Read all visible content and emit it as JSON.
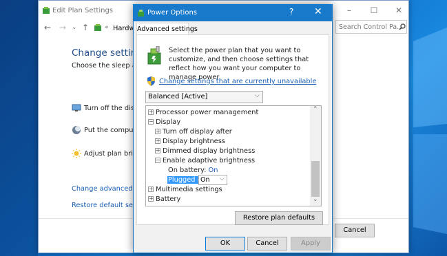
{
  "background_window": {
    "title": "Edit Plan Settings",
    "breadcrumb": "Hardwa",
    "search_placeholder": "Search Control Pa...",
    "heading": "Change settings",
    "subheading": "Choose the sleep and",
    "rows": [
      "Turn off the displa",
      "Put the computer",
      "Adjust plan bright"
    ],
    "links": [
      "Change advanced pov",
      "Restore default setting"
    ],
    "cancel_label": "Cancel"
  },
  "dialog": {
    "title": "Power Options",
    "help_label": "?",
    "close_label": "✕",
    "tab_label": "Advanced settings",
    "intro_text": "Select the power plan that you want to customize, and then choose settings that reflect how you want your computer to manage power.",
    "change_link": "Change settings that are currently unavailable",
    "plan_selected": "Balanced [Active]",
    "tree": {
      "processor": "Processor power management",
      "display": "Display",
      "turn_off_display": "Turn off display after",
      "display_brightness": "Display brightness",
      "dimmed_brightness": "Dimmed display brightness",
      "adaptive_brightness": "Enable adaptive brightness",
      "on_battery_label": "On battery:",
      "on_battery_value": "On",
      "plugged_in_label": "Plugged in:",
      "plugged_in_value": "On",
      "multimedia": "Multimedia settings",
      "battery": "Battery"
    },
    "restore_label": "Restore plan defaults",
    "ok_label": "OK",
    "cancel_label": "Cancel",
    "apply_label": "Apply"
  },
  "colors": {
    "title_bar": "#1979ca",
    "link": "#1a5fb4",
    "heading": "#1e4e8c",
    "highlight": "#3399ff"
  }
}
